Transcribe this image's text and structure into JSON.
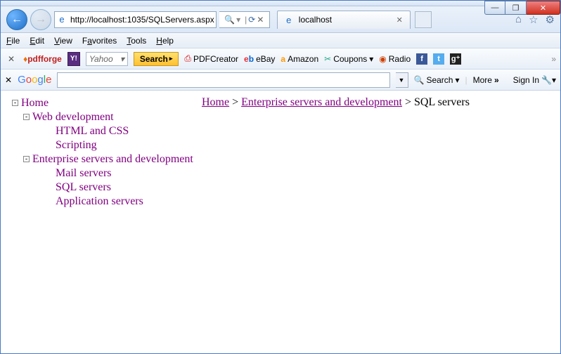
{
  "window": {
    "min": "—",
    "max": "❐",
    "close": "✕"
  },
  "nav": {
    "url": "http://localhost:1035/SQLServers.aspx",
    "search_hint": "🔍 ▾",
    "refresh": "⟳",
    "stop": "✕",
    "tab_title": "localhost",
    "home_icon": "⌂",
    "fav_icon": "☆",
    "gear_icon": "⚙"
  },
  "menu": {
    "file": "File",
    "edit": "Edit",
    "view": "View",
    "favorites": "Favorites",
    "tools": "Tools",
    "help": "Help"
  },
  "toolbar1": {
    "pdfforge": "pdfforge",
    "yahoo_placeholder": "Yahoo",
    "search": "Search",
    "pdfcreator": "PDFCreator",
    "ebay": "eBay",
    "amazon": "Amazon",
    "coupons": "Coupons",
    "radio": "Radio"
  },
  "googlebar": {
    "search": "Search",
    "more": "More",
    "signin": "Sign In"
  },
  "tree": {
    "home": "Home",
    "webdev": "Web development",
    "htmlcss": "HTML and CSS",
    "scripting": "Scripting",
    "enterprise": "Enterprise servers and development",
    "mail": "Mail servers",
    "sql": "SQL servers",
    "app": "Application servers"
  },
  "breadcrumb": {
    "home": "Home",
    "sep": " > ",
    "enterprise": "Enterprise servers and development",
    "current": "SQL servers"
  }
}
